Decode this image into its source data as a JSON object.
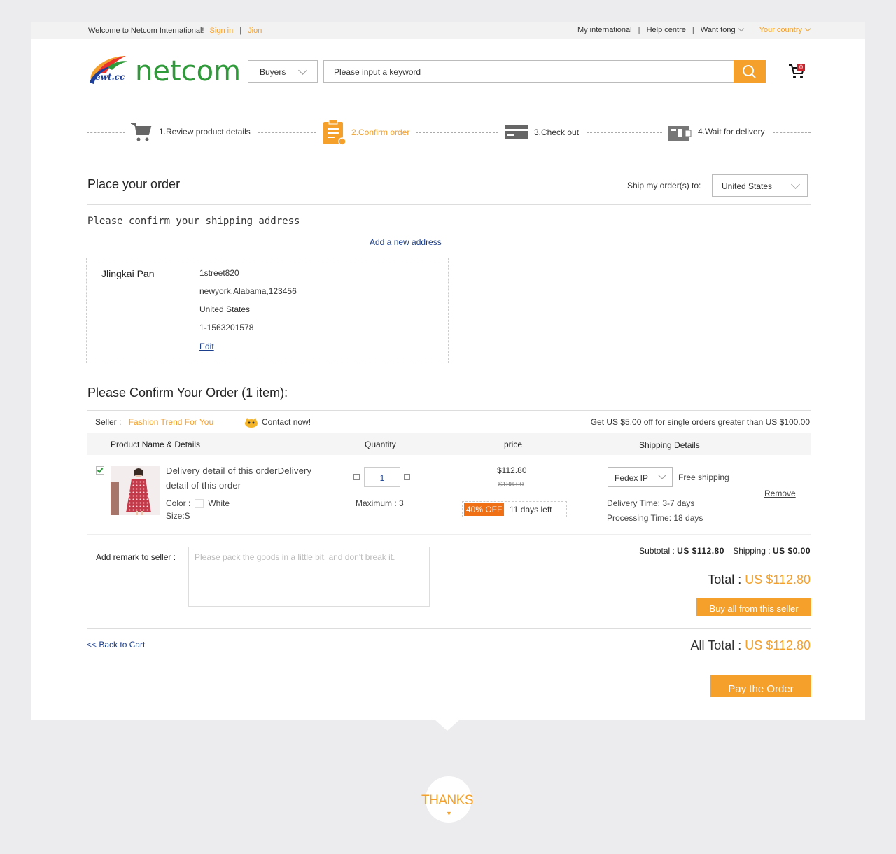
{
  "topbar": {
    "welcome": "Welcome to Netcom International!",
    "sign_in": "Sign in",
    "join": "Jion",
    "my_international": "My international",
    "help_centre": "Help centre",
    "want_tong": "Want tong",
    "your_country": "Your country"
  },
  "header": {
    "logo_text": "netcom",
    "logo_small": "ewt.cc",
    "buyers_label": "Buyers",
    "search_placeholder": "Please input a keyword",
    "cart_count": "0"
  },
  "steps": [
    {
      "label": "1.Review product details",
      "active": false
    },
    {
      "label": "2.Confirm order",
      "active": true
    },
    {
      "label": "3.Check out",
      "active": false
    },
    {
      "label": "4.Wait for delivery",
      "active": false
    }
  ],
  "order": {
    "title": "Place your order",
    "ship_label": "Ship my order(s) to:",
    "ship_country": "United States"
  },
  "address": {
    "heading": "Please confirm your shipping address",
    "add_link": "Add a new address",
    "name": "Jlingkai Pan",
    "street": "1street820",
    "city": "newyork,Alabama,123456",
    "country": "United States",
    "phone": "1-1563201578",
    "edit": "Edit"
  },
  "confirm": {
    "heading": "Please Confirm Your Order (1 item):",
    "seller_label": "Seller :",
    "seller_name": "Fashion Trend For You",
    "contact": "Contact now!",
    "promo": "Get US $5.00 off for single orders greater than US $100.00"
  },
  "table": {
    "col_product": "Product Name & Details",
    "col_quantity": "Quantity",
    "col_price": "price",
    "col_shipping": "Shipping Details"
  },
  "item": {
    "name": "Delivery detail of this orderDelivery detail of this order",
    "color_label": "Color :",
    "color_value": "White",
    "size": "Size:S",
    "quantity": "1",
    "max": "Maximum : 3",
    "price": "$112.80",
    "old_price": "$188.00",
    "discount": "40% OFF",
    "days_left": "11 days left",
    "shipping_method": "Fedex IP",
    "shipping_cost": "Free shipping",
    "delivery_time": "Delivery Time: 3-7 days",
    "processing_time": "Processing Time: 18 days",
    "remove": "Remove"
  },
  "summary": {
    "remark_label": "Add remark to seller :",
    "remark_placeholder": "Please pack the goods in a little bit, and don't break it.",
    "subtotal_label": "Subtotal :",
    "subtotal_value": "US $112.80",
    "shipping_label": "Shipping :",
    "shipping_value": "US $0.00",
    "total_label": "Total :",
    "total_value": "US $112.80",
    "buy_all": "Buy all from this seller",
    "back": "<< Back to Cart",
    "all_total_label": "All Total :",
    "all_total_value": "US $112.80",
    "pay": "Pay the Order"
  },
  "footer": {
    "thanks": "THANKS"
  },
  "colors": {
    "accent": "#f5a02a",
    "link": "#1b3f8c",
    "brand_green": "#2f9a3a",
    "discount": "#f07015"
  }
}
